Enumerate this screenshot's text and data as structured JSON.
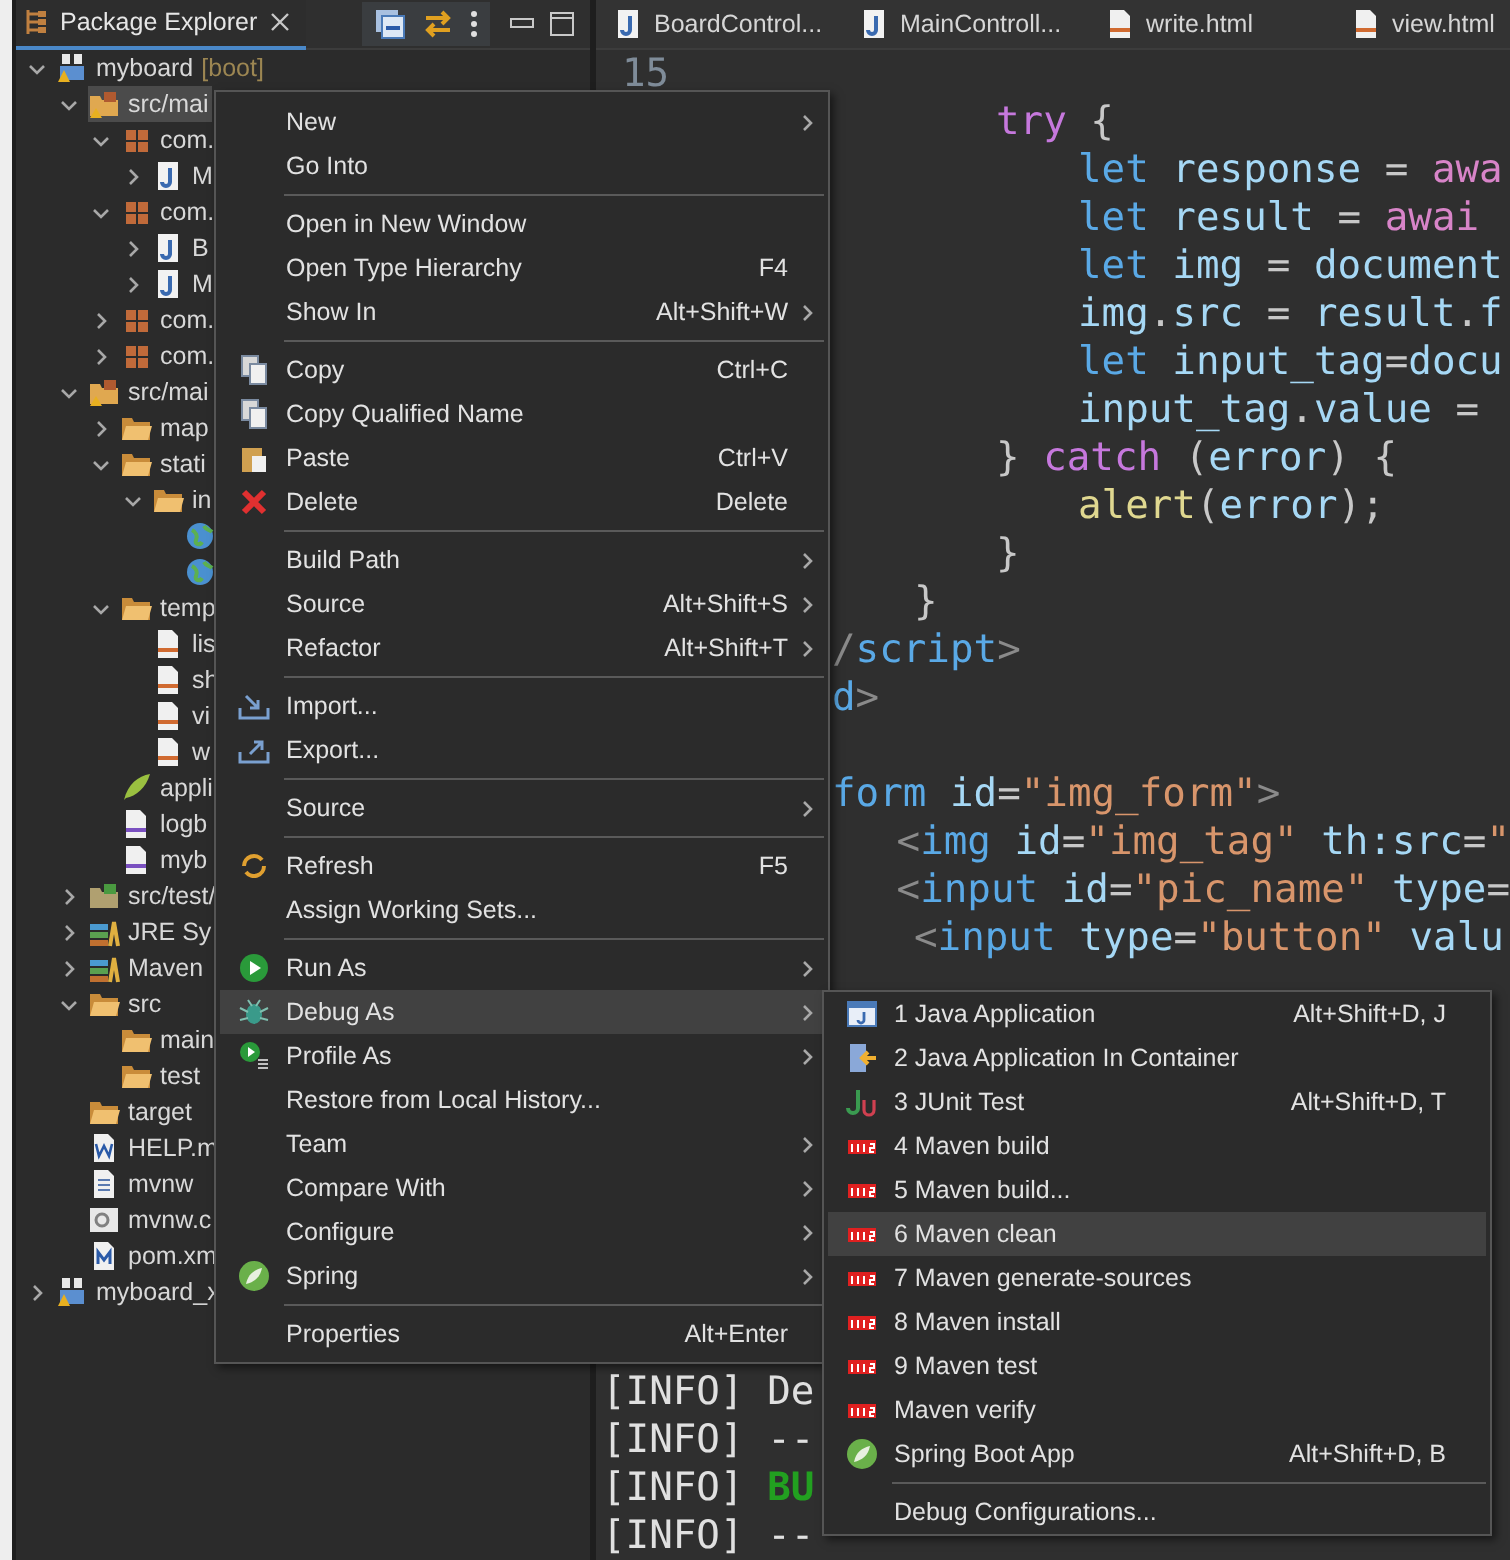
{
  "explorer": {
    "title": "Package Explorer",
    "tree": [
      {
        "kind": "project",
        "label": "myboard",
        "decoration": "[boot]",
        "expanded": true,
        "selected": false,
        "children": [
          {
            "kind": "srcfolder",
            "label": "src/mai",
            "expanded": true,
            "selected": true,
            "children": [
              {
                "kind": "package",
                "label": "com.",
                "expanded": true,
                "selected": false,
                "children": [
                  {
                    "kind": "java",
                    "label": "M",
                    "expanded": false,
                    "selected": false
                  }
                ]
              },
              {
                "kind": "package",
                "label": "com.",
                "expanded": true,
                "selected": false,
                "children": [
                  {
                    "kind": "interface",
                    "label": "B",
                    "expanded": false,
                    "selected": false
                  },
                  {
                    "kind": "java",
                    "label": "M",
                    "expanded": false,
                    "selected": false
                  }
                ]
              },
              {
                "kind": "package",
                "label": "com.",
                "expanded": false,
                "selected": false
              },
              {
                "kind": "package",
                "label": "com.",
                "expanded": false,
                "selected": false
              }
            ]
          },
          {
            "kind": "srcfolder",
            "label": "src/mai",
            "expanded": true,
            "selected": false,
            "children": [
              {
                "kind": "folder",
                "label": "map",
                "expanded": false,
                "selected": false
              },
              {
                "kind": "folder",
                "label": "stati",
                "expanded": true,
                "selected": false,
                "children": [
                  {
                    "kind": "folder",
                    "label": "in",
                    "expanded": true,
                    "selected": false,
                    "children": [
                      {
                        "kind": "web",
                        "selected": false
                      },
                      {
                        "kind": "web",
                        "selected": false
                      }
                    ]
                  }
                ]
              },
              {
                "kind": "folder",
                "label": "temp",
                "expanded": true,
                "selected": false,
                "children": [
                  {
                    "kind": "html",
                    "label": "lis",
                    "selected": false
                  },
                  {
                    "kind": "html",
                    "label": "sh",
                    "selected": false
                  },
                  {
                    "kind": "html",
                    "label": "vi",
                    "selected": false
                  },
                  {
                    "kind": "html",
                    "label": "w",
                    "selected": false
                  }
                ]
              },
              {
                "kind": "leaf",
                "label": "appli",
                "selected": false
              },
              {
                "kind": "xml",
                "label": "logb",
                "selected": false
              },
              {
                "kind": "xml",
                "label": "myb",
                "selected": false
              }
            ]
          },
          {
            "kind": "testfolder",
            "label": "src/test/",
            "expanded": false,
            "selected": false
          },
          {
            "kind": "library",
            "label": "JRE Sy",
            "expanded": false,
            "selected": false
          },
          {
            "kind": "library",
            "label": "Maven",
            "expanded": false,
            "selected": false
          },
          {
            "kind": "folder",
            "label": "src",
            "expanded": true,
            "selected": false,
            "children": [
              {
                "kind": "folder",
                "label": "main",
                "selected": false
              },
              {
                "kind": "folder",
                "label": "test",
                "selected": false
              }
            ]
          },
          {
            "kind": "folder",
            "label": "target",
            "selected": false
          },
          {
            "kind": "word",
            "label": "HELP.m",
            "selected": false
          },
          {
            "kind": "text",
            "label": "mvnw",
            "selected": false
          },
          {
            "kind": "settings",
            "label": "mvnw.c",
            "selected": false
          },
          {
            "kind": "pom",
            "label": "pom.xm",
            "selected": false
          }
        ]
      },
      {
        "kind": "project",
        "label": "myboard_x",
        "expanded": false,
        "selected": false
      }
    ]
  },
  "editor": {
    "tabs": [
      {
        "kind": "java",
        "label": "BoardControl..."
      },
      {
        "kind": "java",
        "label": "MainControll..."
      },
      {
        "kind": "html",
        "label": "write.html"
      },
      {
        "kind": "html",
        "label": "view.html"
      }
    ],
    "lines": [
      {
        "number": "15"
      },
      {
        "children": [
          {
            "children": [
              {
                "tokens": [
                  {
                    "kind": "kw",
                    "text": "try"
                  },
                  {
                    "kind": "op",
                    "text": " {"
                  }
                ],
                "children": [
                  {
                    "tokens": [
                      {
                        "kind": "decl",
                        "text": "let"
                      },
                      {
                        "kind": "id",
                        "text": " response"
                      },
                      {
                        "kind": "op",
                        "text": " = "
                      },
                      {
                        "kind": "await",
                        "text": "awa"
                      }
                    ]
                  },
                  {
                    "tokens": [
                      {
                        "kind": "decl",
                        "text": "let"
                      },
                      {
                        "kind": "id",
                        "text": " result"
                      },
                      {
                        "kind": "op",
                        "text": " = "
                      },
                      {
                        "kind": "await",
                        "text": "awai"
                      }
                    ]
                  },
                  {
                    "tokens": [
                      {
                        "kind": "decl",
                        "text": "let"
                      },
                      {
                        "kind": "id",
                        "text": " img"
                      },
                      {
                        "kind": "op",
                        "text": " = "
                      },
                      {
                        "kind": "id",
                        "text": "document"
                      }
                    ]
                  },
                  {
                    "tokens": [
                      {
                        "kind": "id",
                        "text": "img"
                      },
                      {
                        "kind": "op",
                        "text": "."
                      },
                      {
                        "kind": "id",
                        "text": "src"
                      },
                      {
                        "kind": "op",
                        "text": " = "
                      },
                      {
                        "kind": "id",
                        "text": "result"
                      },
                      {
                        "kind": "op",
                        "text": "."
                      },
                      {
                        "kind": "id",
                        "text": "f"
                      }
                    ]
                  },
                  {
                    "tokens": [
                      {
                        "kind": "decl",
                        "text": "let"
                      },
                      {
                        "kind": "id",
                        "text": " input_tag"
                      },
                      {
                        "kind": "op",
                        "text": "="
                      },
                      {
                        "kind": "id",
                        "text": "docu"
                      }
                    ]
                  },
                  {
                    "tokens": [
                      {
                        "kind": "id",
                        "text": "input_tag"
                      },
                      {
                        "kind": "op",
                        "text": "."
                      },
                      {
                        "kind": "id",
                        "text": "value"
                      },
                      {
                        "kind": "op",
                        "text": " ="
                      }
                    ]
                  }
                ]
              },
              {
                "tokens": [
                  {
                    "kind": "op",
                    "text": "} "
                  },
                  {
                    "kind": "kw",
                    "text": "catch"
                  },
                  {
                    "kind": "op",
                    "text": " ("
                  },
                  {
                    "kind": "id",
                    "text": "error"
                  },
                  {
                    "kind": "op",
                    "text": ") {"
                  }
                ],
                "children": [
                  {
                    "tokens": [
                      {
                        "kind": "fn",
                        "text": "alert"
                      },
                      {
                        "kind": "op",
                        "text": "("
                      },
                      {
                        "kind": "id",
                        "text": "error"
                      },
                      {
                        "kind": "op",
                        "text": ");"
                      }
                    ]
                  }
                ]
              },
              {
                "tokens": [
                  {
                    "kind": "op",
                    "text": "}"
                  }
                ]
              }
            ]
          },
          {
            "tokens": [
              {
                "kind": "op",
                "text": "}"
              }
            ]
          }
        ]
      },
      {
        "tokens": [
          {
            "kind": "bracket",
            "text": "/"
          },
          {
            "kind": "tag",
            "text": "script"
          },
          {
            "kind": "bracket",
            "text": ">"
          }
        ]
      },
      {
        "tokens": [
          {
            "kind": "tag",
            "text": "d"
          },
          {
            "kind": "bracket",
            "text": ">"
          }
        ]
      },
      {
        "kind": "blank"
      },
      {
        "tokens": [
          {
            "kind": "tag",
            "text": "form"
          },
          {
            "kind": "attr",
            "text": " id"
          },
          {
            "kind": "op",
            "text": "="
          },
          {
            "kind": "str",
            "text": "\"img_form\""
          },
          {
            "kind": "bracket",
            "text": ">"
          }
        ],
        "children": [
          {
            "tokens": [
              {
                "kind": "bracket",
                "text": "<"
              },
              {
                "kind": "tag",
                "text": "img"
              },
              {
                "kind": "attr",
                "text": " id"
              },
              {
                "kind": "op",
                "text": "="
              },
              {
                "kind": "str",
                "text": "\"img_tag\""
              },
              {
                "kind": "attr",
                "text": " th:src"
              },
              {
                "kind": "op",
                "text": "="
              },
              {
                "kind": "str",
                "text": "\""
              }
            ]
          },
          {
            "tokens": [
              {
                "kind": "bracket",
                "text": "<"
              },
              {
                "kind": "tag",
                "text": "input"
              },
              {
                "kind": "attr",
                "text": " id"
              },
              {
                "kind": "op",
                "text": "="
              },
              {
                "kind": "str",
                "text": "\"pic_name\""
              },
              {
                "kind": "attr",
                "text": " type"
              },
              {
                "kind": "op",
                "text": "="
              }
            ]
          },
          {
            "tokens": [
              {
                "kind": "bracket",
                "text": "<"
              },
              {
                "kind": "tag",
                "text": "input"
              },
              {
                "kind": "attr",
                "text": " type"
              },
              {
                "kind": "op",
                "text": "="
              },
              {
                "kind": "str",
                "text": "\"button\""
              },
              {
                "kind": "attr",
                "text": " valu"
              }
            ]
          }
        ]
      }
    ]
  },
  "console": [
    {
      "prefix": "[INFO]",
      "text": "De",
      "kind": "plain"
    },
    {
      "prefix": "[INFO]",
      "text": "--",
      "kind": "plain"
    },
    {
      "prefix": "[INFO]",
      "text": "BU",
      "kind": "success"
    },
    {
      "prefix": "[INFO]",
      "text": "--",
      "kind": "plain"
    }
  ],
  "context_menu": [
    {
      "kind": "plain",
      "label": "New",
      "submenu": true,
      "selected": false
    },
    {
      "kind": "plain",
      "label": "Go Into",
      "submenu": false,
      "selected": false
    },
    {
      "kind": "separator"
    },
    {
      "kind": "plain",
      "label": "Open in New Window",
      "submenu": false,
      "selected": false
    },
    {
      "kind": "plain",
      "label": "Open Type Hierarchy",
      "shortcut": "F4",
      "submenu": false,
      "selected": false
    },
    {
      "kind": "plain",
      "label": "Show In",
      "shortcut": "Alt+Shift+W",
      "submenu": true,
      "selected": false
    },
    {
      "kind": "separator"
    },
    {
      "kind": "copy",
      "label": "Copy",
      "shortcut": "Ctrl+C",
      "submenu": false,
      "selected": false
    },
    {
      "kind": "copy",
      "label": "Copy Qualified Name",
      "submenu": false,
      "selected": false
    },
    {
      "kind": "paste",
      "label": "Paste",
      "shortcut": "Ctrl+V",
      "submenu": false,
      "selected": false
    },
    {
      "kind": "delete",
      "label": "Delete",
      "shortcut": "Delete",
      "submenu": false,
      "selected": false
    },
    {
      "kind": "separator"
    },
    {
      "kind": "plain",
      "label": "Build Path",
      "submenu": true,
      "selected": false
    },
    {
      "kind": "plain",
      "label": "Source",
      "shortcut": "Alt+Shift+S",
      "submenu": true,
      "selected": false
    },
    {
      "kind": "plain",
      "label": "Refactor",
      "shortcut": "Alt+Shift+T",
      "submenu": true,
      "selected": false
    },
    {
      "kind": "separator"
    },
    {
      "kind": "import",
      "label": "Import...",
      "submenu": false,
      "selected": false
    },
    {
      "kind": "export",
      "label": "Export...",
      "submenu": false,
      "selected": false
    },
    {
      "kind": "separator"
    },
    {
      "kind": "plain",
      "label": "Source",
      "submenu": true,
      "selected": false
    },
    {
      "kind": "separator"
    },
    {
      "kind": "refresh",
      "label": "Refresh",
      "shortcut": "F5",
      "submenu": false,
      "selected": false
    },
    {
      "kind": "plain",
      "label": "Assign Working Sets...",
      "submenu": false,
      "selected": false
    },
    {
      "kind": "separator"
    },
    {
      "kind": "run",
      "label": "Run As",
      "submenu": true,
      "selected": false
    },
    {
      "kind": "debug",
      "label": "Debug As",
      "submenu": true,
      "selected": true
    },
    {
      "kind": "profile",
      "label": "Profile As",
      "submenu": true,
      "selected": false
    },
    {
      "kind": "plain",
      "label": "Restore from Local History...",
      "submenu": false,
      "selected": false
    },
    {
      "kind": "plain",
      "label": "Team",
      "submenu": true,
      "selected": false
    },
    {
      "kind": "plain",
      "label": "Compare With",
      "submenu": true,
      "selected": false
    },
    {
      "kind": "plain",
      "label": "Configure",
      "submenu": true,
      "selected": false
    },
    {
      "kind": "spring",
      "label": "Spring",
      "submenu": true,
      "selected": false
    },
    {
      "kind": "separator"
    },
    {
      "kind": "plain",
      "label": "Properties",
      "shortcut": "Alt+Enter",
      "submenu": false,
      "selected": false
    }
  ],
  "debug_submenu": [
    {
      "kind": "java-app",
      "label": "1 Java Application",
      "shortcut": "Alt+Shift+D, J",
      "selected": false
    },
    {
      "kind": "container",
      "label": "2 Java Application In Container",
      "selected": false
    },
    {
      "kind": "junit",
      "label": "3 JUnit Test",
      "shortcut": "Alt+Shift+D, T",
      "selected": false
    },
    {
      "kind": "maven",
      "label": "4 Maven build",
      "selected": false
    },
    {
      "kind": "maven",
      "label": "5 Maven build...",
      "selected": false
    },
    {
      "kind": "maven",
      "label": "6 Maven clean",
      "selected": true
    },
    {
      "kind": "maven",
      "label": "7 Maven generate-sources",
      "selected": false
    },
    {
      "kind": "maven",
      "label": "8 Maven install",
      "selected": false
    },
    {
      "kind": "maven",
      "label": "9 Maven test",
      "selected": false
    },
    {
      "kind": "maven",
      "label": "Maven verify",
      "selected": false
    },
    {
      "kind": "spring",
      "label": "Spring Boot App",
      "shortcut": "Alt+Shift+D, B",
      "selected": false
    },
    {
      "kind": "separator"
    },
    {
      "kind": "plain",
      "label": "Debug Configurations...",
      "selected": false
    }
  ]
}
